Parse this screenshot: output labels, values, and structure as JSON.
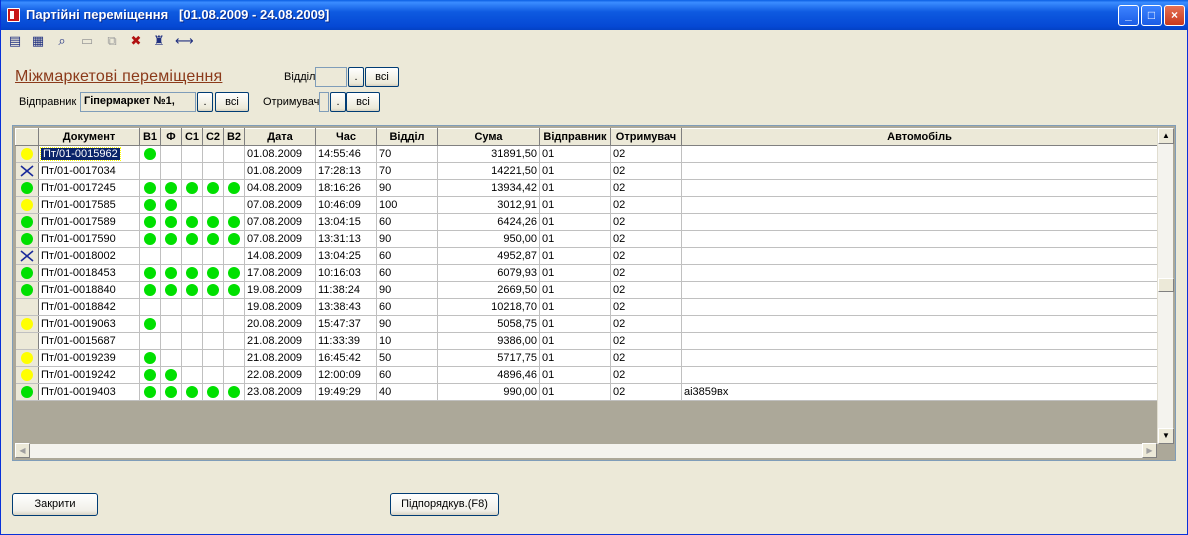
{
  "window": {
    "title": "Партійні переміщення   [01.08.2009 - 24.08.2009]",
    "minimize_glyph": "_",
    "maximize_glyph": "□",
    "close_glyph": "×"
  },
  "toolbar": {
    "icons": [
      "new-doc-icon",
      "edit-doc-icon",
      "preview-icon",
      "add-row-icon",
      "copy-icon",
      "delete-icon",
      "find-icon",
      "fit-width-icon"
    ]
  },
  "filters": {
    "section_title": "Міжмаркетові переміщення",
    "department_label": "Відділ",
    "department_value": "",
    "sender_label": "Відправник",
    "sender_value": "Гіпермаркет №1,",
    "receiver_label": "Отримувач",
    "receiver_value": "",
    "pick_label": ".",
    "all_label": "всі"
  },
  "grid": {
    "columns": [
      "",
      "Документ",
      "В1",
      "Ф",
      "С1",
      "С2",
      "В2",
      "Дата",
      "Час",
      "Відділ",
      "Сума",
      "Відправник",
      "Отримувач",
      "Автомобіль"
    ],
    "rows": [
      {
        "ind": "yellow",
        "doc": "Пт/01-0015962",
        "flags": [
          1,
          0,
          0,
          0,
          0
        ],
        "date": "01.08.2009",
        "time": "14:55:46",
        "dept": "70",
        "sum": "31891,50",
        "from": "01",
        "to": "02",
        "car": ""
      },
      {
        "ind": "cross",
        "doc": "Пт/01-0017034",
        "flags": [
          0,
          0,
          0,
          0,
          0
        ],
        "date": "01.08.2009",
        "time": "17:28:13",
        "dept": "70",
        "sum": "14221,50",
        "from": "01",
        "to": "02",
        "car": ""
      },
      {
        "ind": "green",
        "doc": "Пт/01-0017245",
        "flags": [
          1,
          1,
          1,
          1,
          1
        ],
        "date": "04.08.2009",
        "time": "18:16:26",
        "dept": "90",
        "sum": "13934,42",
        "from": "01",
        "to": "02",
        "car": ""
      },
      {
        "ind": "yellow",
        "doc": "Пт/01-0017585",
        "flags": [
          1,
          1,
          0,
          0,
          0
        ],
        "date": "07.08.2009",
        "time": "10:46:09",
        "dept": "100",
        "sum": "3012,91",
        "from": "01",
        "to": "02",
        "car": ""
      },
      {
        "ind": "green",
        "doc": "Пт/01-0017589",
        "flags": [
          1,
          1,
          1,
          1,
          1
        ],
        "date": "07.08.2009",
        "time": "13:04:15",
        "dept": "60",
        "sum": "6424,26",
        "from": "01",
        "to": "02",
        "car": ""
      },
      {
        "ind": "green",
        "doc": "Пт/01-0017590",
        "flags": [
          1,
          1,
          1,
          1,
          1
        ],
        "date": "07.08.2009",
        "time": "13:31:13",
        "dept": "90",
        "sum": "950,00",
        "from": "01",
        "to": "02",
        "car": ""
      },
      {
        "ind": "cross",
        "doc": "Пт/01-0018002",
        "flags": [
          0,
          0,
          0,
          0,
          0
        ],
        "date": "14.08.2009",
        "time": "13:04:25",
        "dept": "60",
        "sum": "4952,87",
        "from": "01",
        "to": "02",
        "car": ""
      },
      {
        "ind": "green",
        "doc": "Пт/01-0018453",
        "flags": [
          1,
          1,
          1,
          1,
          1
        ],
        "date": "17.08.2009",
        "time": "10:16:03",
        "dept": "60",
        "sum": "6079,93",
        "from": "01",
        "to": "02",
        "car": ""
      },
      {
        "ind": "green",
        "doc": "Пт/01-0018840",
        "flags": [
          1,
          1,
          1,
          1,
          1
        ],
        "date": "19.08.2009",
        "time": "11:38:24",
        "dept": "90",
        "sum": "2669,50",
        "from": "01",
        "to": "02",
        "car": ""
      },
      {
        "ind": "none",
        "doc": "Пт/01-0018842",
        "flags": [
          0,
          0,
          0,
          0,
          0
        ],
        "date": "19.08.2009",
        "time": "13:38:43",
        "dept": "60",
        "sum": "10218,70",
        "from": "01",
        "to": "02",
        "car": ""
      },
      {
        "ind": "yellow",
        "doc": "Пт/01-0019063",
        "flags": [
          1,
          0,
          0,
          0,
          0
        ],
        "date": "20.08.2009",
        "time": "15:47:37",
        "dept": "90",
        "sum": "5058,75",
        "from": "01",
        "to": "02",
        "car": ""
      },
      {
        "ind": "none",
        "doc": "Пт/01-0015687",
        "flags": [
          0,
          0,
          0,
          0,
          0
        ],
        "date": "21.08.2009",
        "time": "11:33:39",
        "dept": "10",
        "sum": "9386,00",
        "from": "01",
        "to": "02",
        "car": ""
      },
      {
        "ind": "yellow",
        "doc": "Пт/01-0019239",
        "flags": [
          1,
          0,
          0,
          0,
          0
        ],
        "date": "21.08.2009",
        "time": "16:45:42",
        "dept": "50",
        "sum": "5717,75",
        "from": "01",
        "to": "02",
        "car": ""
      },
      {
        "ind": "yellow",
        "doc": "Пт/01-0019242",
        "flags": [
          1,
          1,
          0,
          0,
          0
        ],
        "date": "22.08.2009",
        "time": "12:00:09",
        "dept": "60",
        "sum": "4896,46",
        "from": "01",
        "to": "02",
        "car": ""
      },
      {
        "ind": "green",
        "doc": "Пт/01-0019403",
        "flags": [
          1,
          1,
          1,
          1,
          1
        ],
        "date": "23.08.2009",
        "time": "19:49:29",
        "dept": "40",
        "sum": "990,00",
        "from": "01",
        "to": "02",
        "car": "аі3859вх"
      }
    ]
  },
  "buttons": {
    "close": "Закрити",
    "subtotal": "Підпорядкув.(F8)"
  },
  "colors": {
    "green": "#00e000",
    "yellow": "#ffff00",
    "cross": "#1a2a9a",
    "title_link": "#8b3a1a"
  }
}
